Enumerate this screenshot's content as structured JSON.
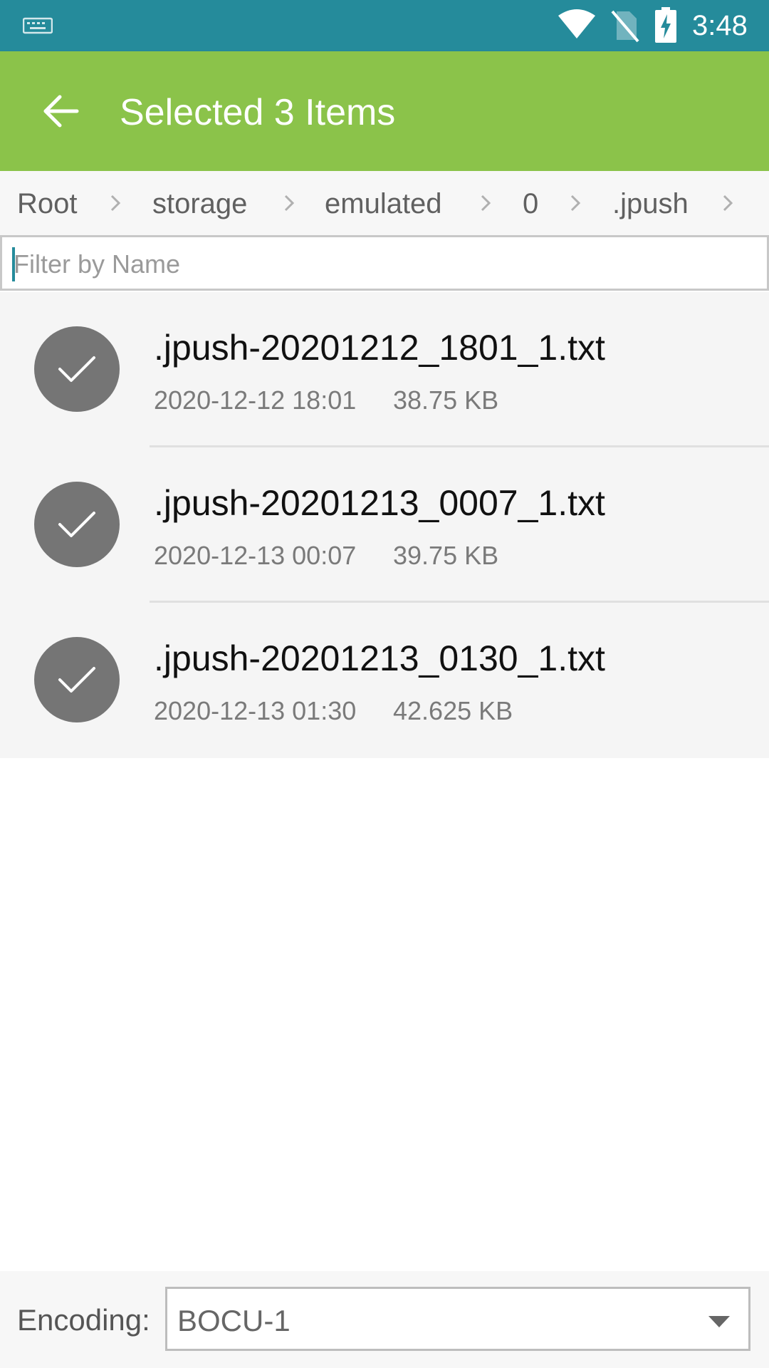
{
  "status_bar": {
    "time": "3:48",
    "icons": [
      "keyboard-icon",
      "wifi-icon",
      "no-sim-icon",
      "battery-charging-icon"
    ]
  },
  "app_bar": {
    "title": "Selected 3 Items",
    "back_icon": "arrow-back-icon",
    "background": "#8bc34a"
  },
  "breadcrumb": {
    "items": [
      "Root",
      "storage",
      "emulated",
      "0",
      ".jpush"
    ]
  },
  "filter": {
    "placeholder": "Filter by Name",
    "value": ""
  },
  "files": [
    {
      "name": ".jpush-20201212_1801_1.txt",
      "date": "2020-12-12 18:01",
      "size": "38.75 KB",
      "selected": true
    },
    {
      "name": ".jpush-20201213_0007_1.txt",
      "date": "2020-12-13 00:07",
      "size": "39.75 KB",
      "selected": true
    },
    {
      "name": ".jpush-20201213_0130_1.txt",
      "date": "2020-12-13 01:30",
      "size": "42.625 KB",
      "selected": true
    }
  ],
  "encoding": {
    "label": "Encoding:",
    "selected": "BOCU-1"
  },
  "colors": {
    "status_bar": "#258b9b",
    "accent": "#8bc34a",
    "check_circle": "#757575"
  }
}
